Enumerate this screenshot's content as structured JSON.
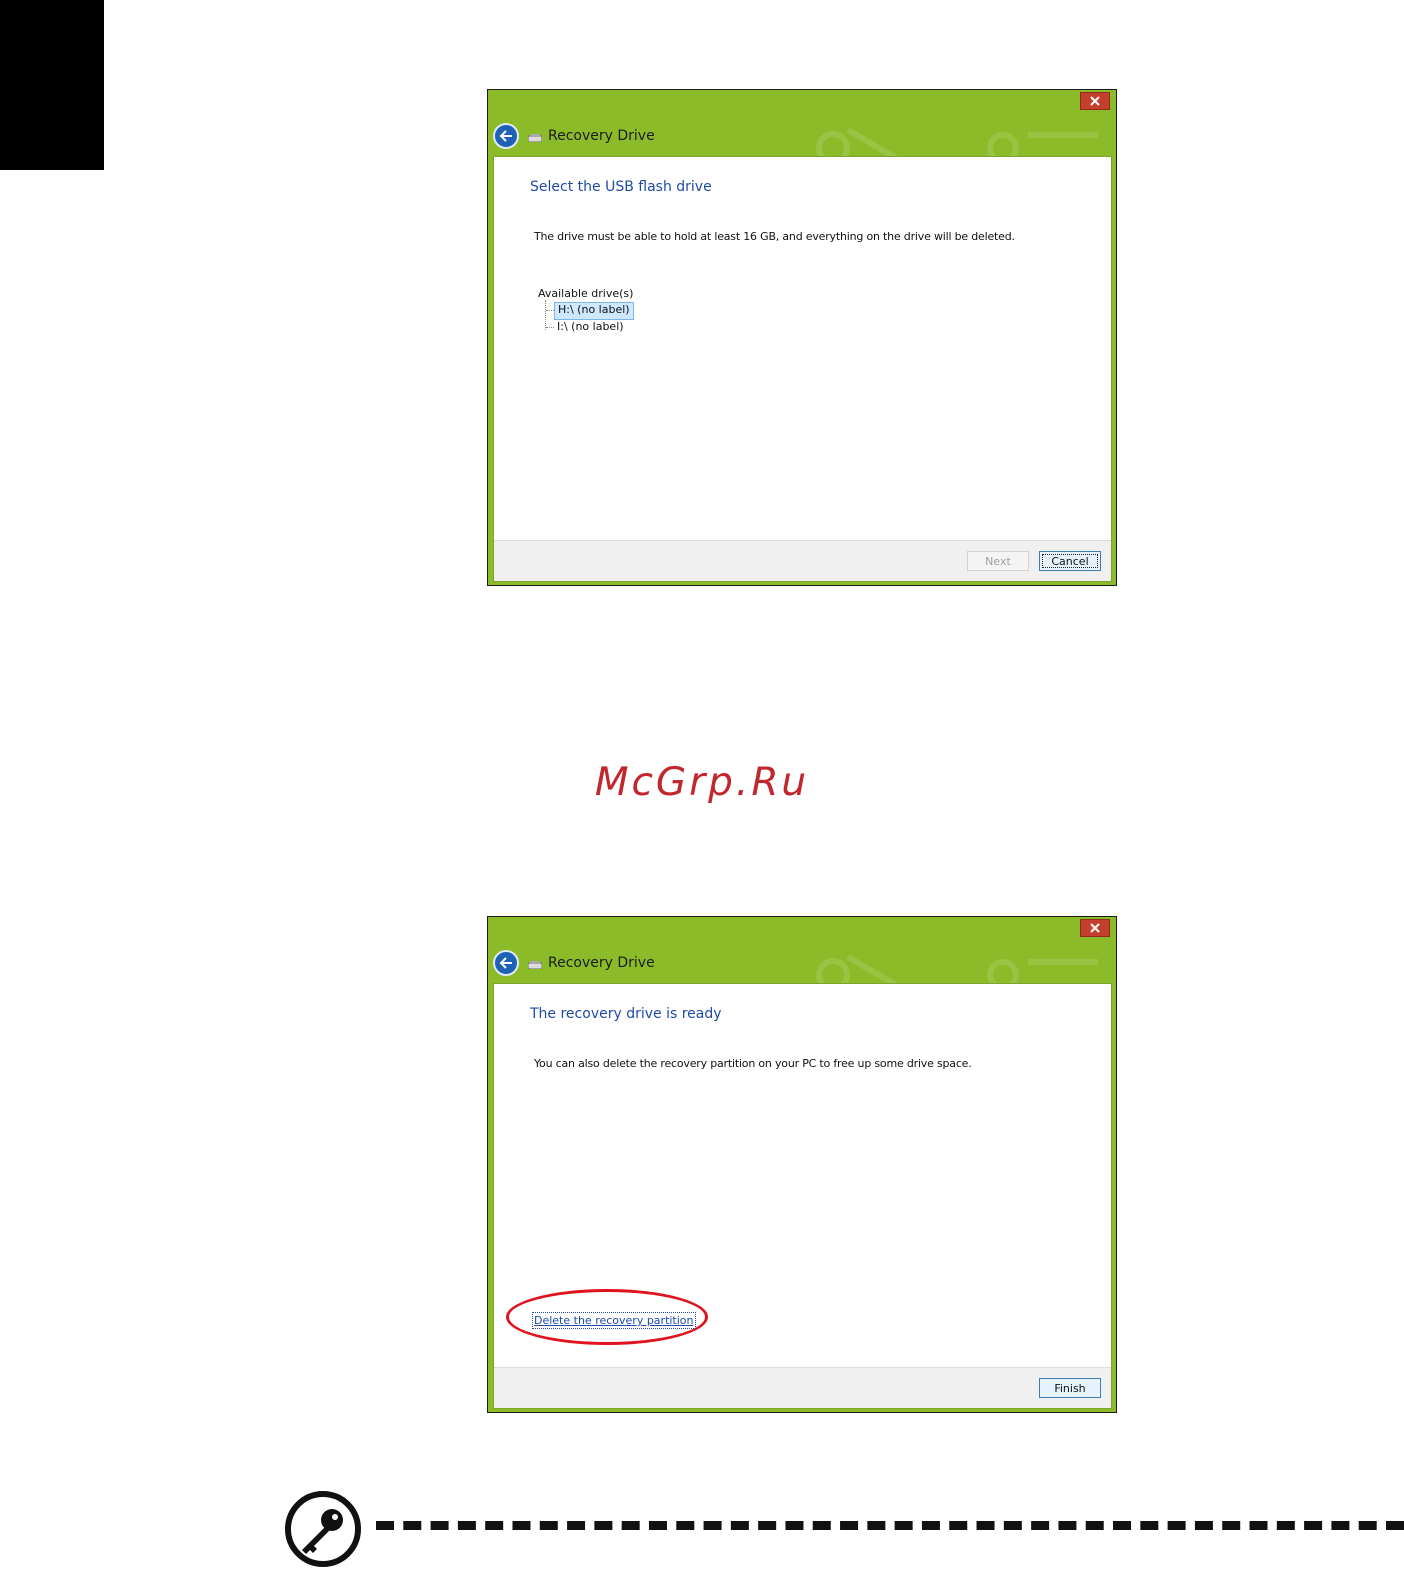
{
  "watermark": "McGrp.Ru",
  "windows": [
    {
      "title": "Recovery Drive",
      "heading": "Select the USB flash drive",
      "message": "The drive must be able to hold at least 16 GB, and everything on the drive will be deleted.",
      "drive_list_label": "Available drive(s)",
      "drives": [
        {
          "label": "H:\\ (no label)",
          "selected": true
        },
        {
          "label": "I:\\ (no label)",
          "selected": false
        }
      ],
      "buttons": {
        "next": "Next",
        "cancel": "Cancel"
      }
    },
    {
      "title": "Recovery Drive",
      "heading": "The recovery drive is ready",
      "message": "You can also delete the recovery partition on your PC to free up some drive space.",
      "link": "Delete the recovery partition",
      "buttons": {
        "finish": "Finish"
      }
    }
  ],
  "colors": {
    "title_bar": "#8cbb2a",
    "heading": "#1f4aa8",
    "highlight_ring": "#e0141e",
    "watermark": "#c1272d",
    "close_button": "#c5402c"
  }
}
